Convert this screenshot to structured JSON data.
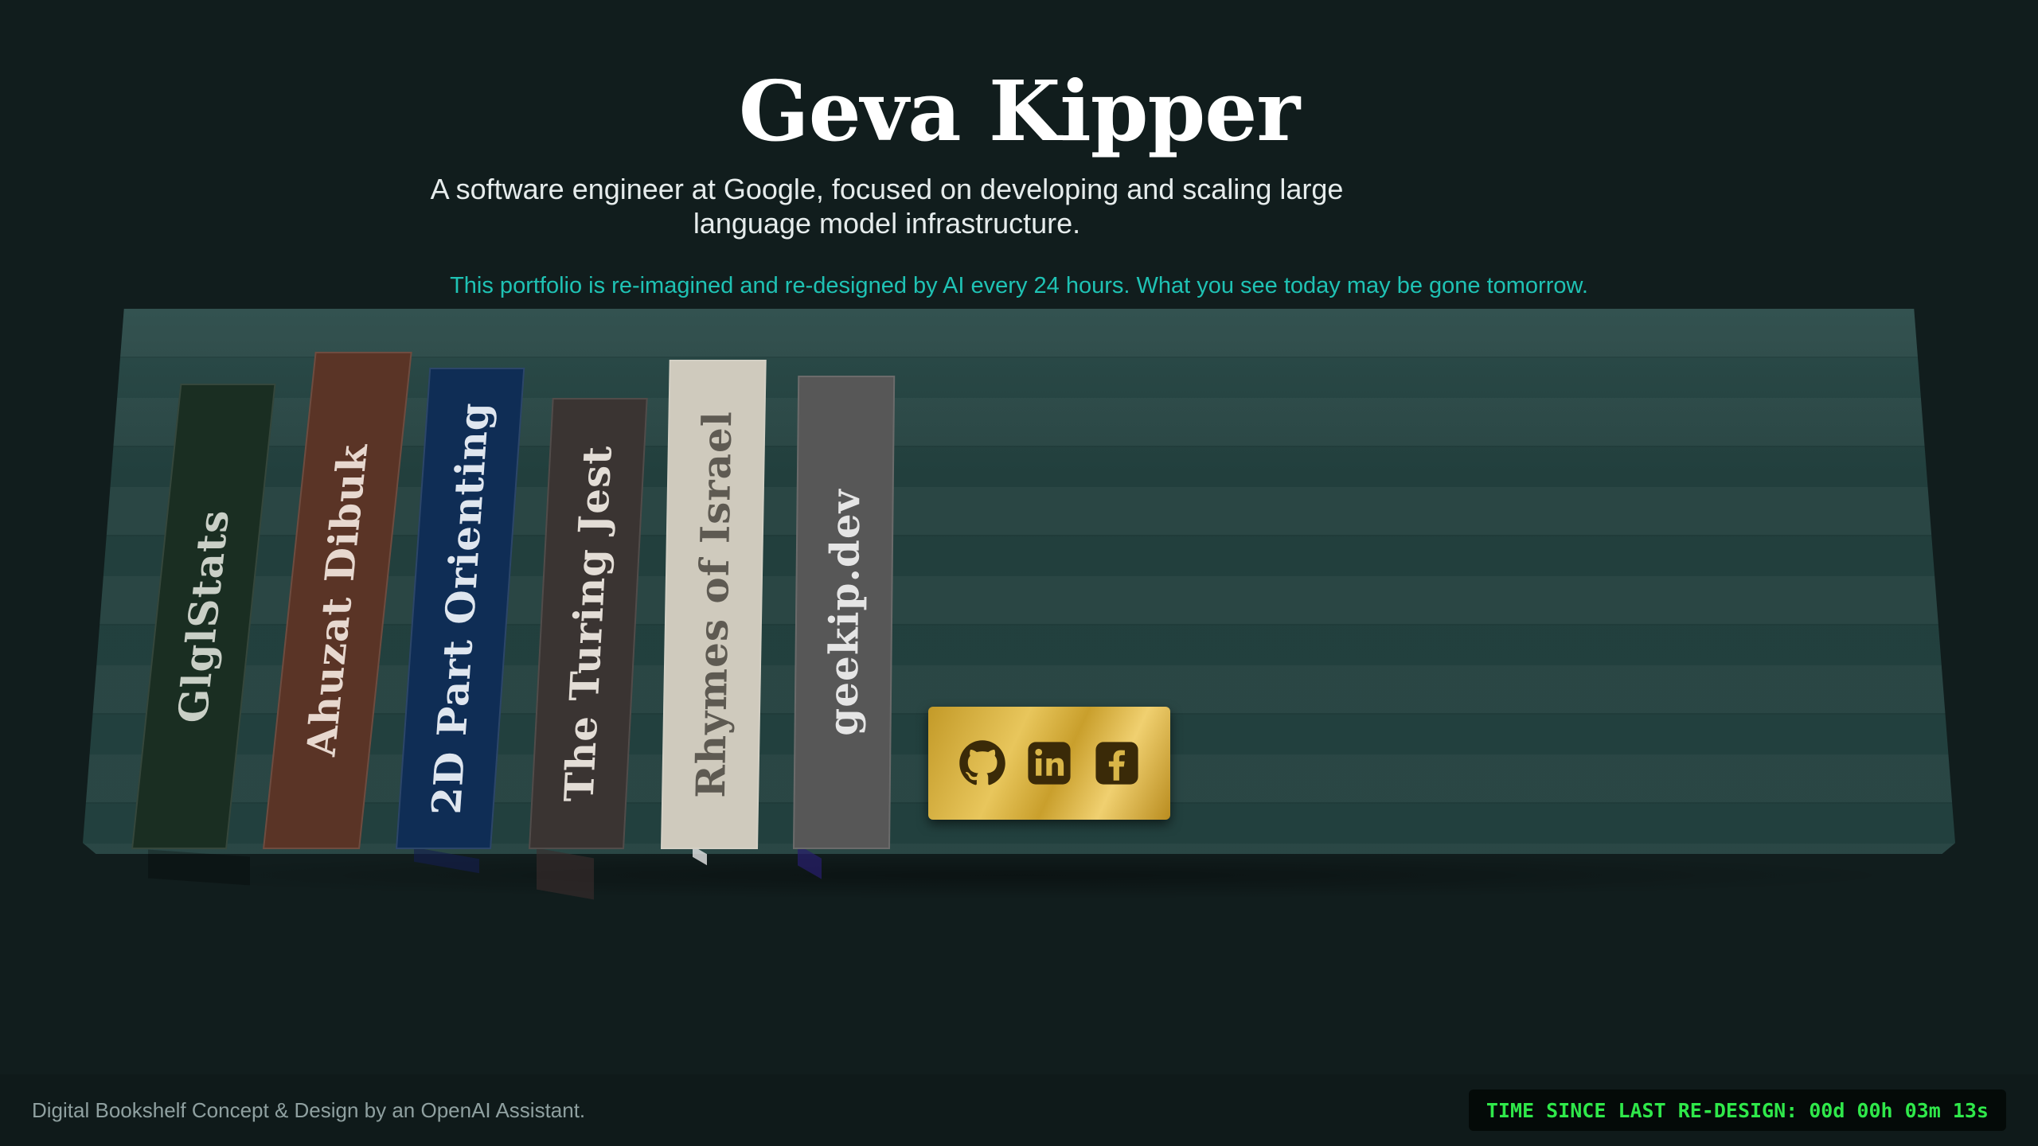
{
  "header": {
    "name": "Geva Kipper",
    "tagline": "A software engineer at Google, focused on developing and scaling large language model infrastructure.",
    "notice": "This portfolio is re-imagined and re-designed by AI every 24 hours. What you see today may be gone tomorrow."
  },
  "books": [
    {
      "title": "GlglStats",
      "color": "#1a2e22",
      "text_color": "#c9cfc6"
    },
    {
      "title": "Ahuzat Dibuk",
      "color": "#5a3426",
      "text_color": "#e7d8cf"
    },
    {
      "title": "2D Part Orienting",
      "color": "#0f2d55",
      "text_color": "#dfe6ef"
    },
    {
      "title": "The Turing Jest",
      "color": "#3a3432",
      "text_color": "#e3ddd6"
    },
    {
      "title": "Rhymes of Israel",
      "color": "#cfcabd",
      "text_color": "#5e5a52"
    },
    {
      "title": "geekip.dev",
      "color": "#575757",
      "text_color": "#e5e5e5"
    }
  ],
  "social": [
    {
      "name": "GitHub",
      "icon": "github-icon"
    },
    {
      "name": "LinkedIn",
      "icon": "linkedin-icon"
    },
    {
      "name": "Facebook",
      "icon": "facebook-icon"
    }
  ],
  "footer": {
    "credit": "Digital Bookshelf Concept & Design by an OpenAI Assistant.",
    "timer_label": "TIME SINCE LAST RE-DESIGN:",
    "timer_value": "00d 00h 03m 13s"
  },
  "colors": {
    "background": "#111d1d",
    "shelf": "#22403e",
    "accent": "#1fc2b4",
    "timer_green": "#2fe84a",
    "gold": "#d4af37"
  }
}
